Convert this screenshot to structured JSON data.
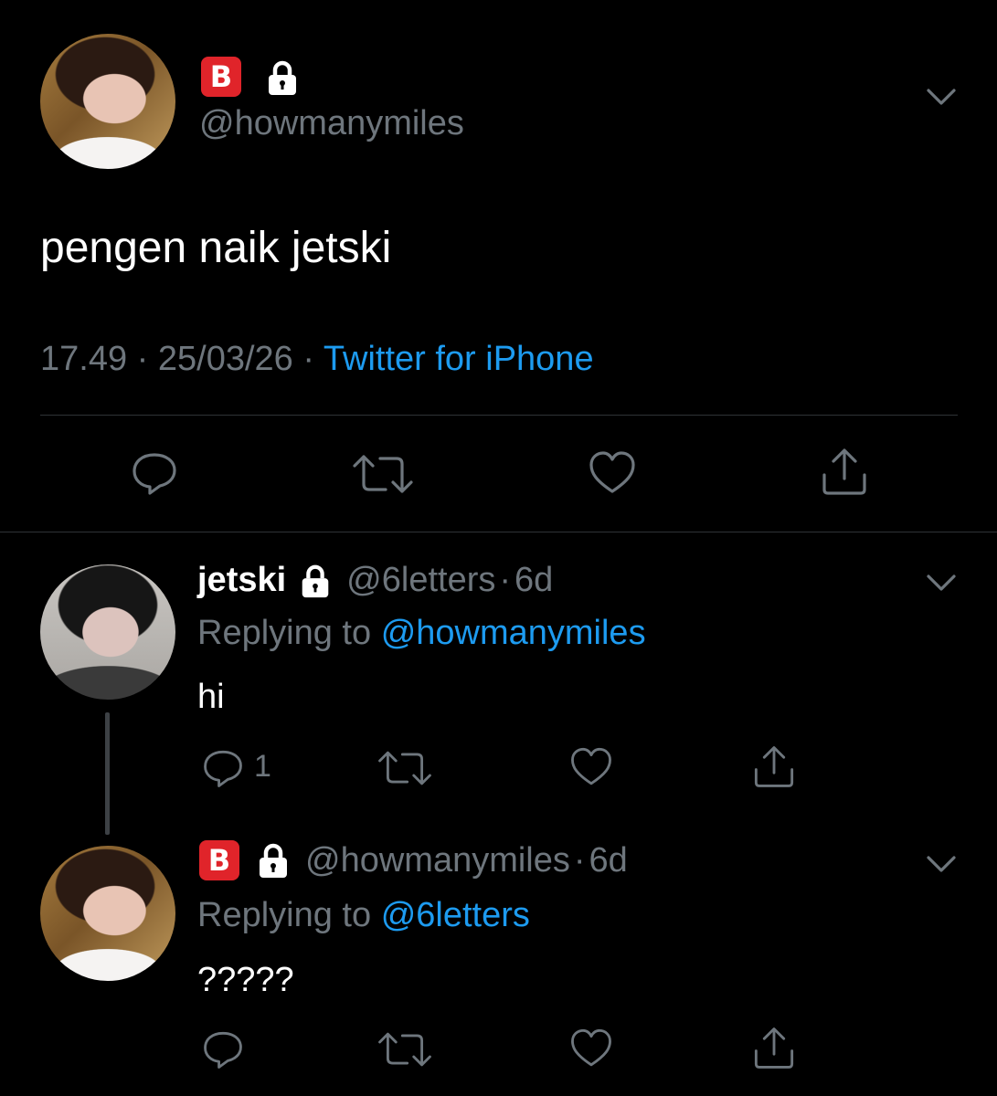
{
  "main_tweet": {
    "badge": "B",
    "handle": "@howmanymiles",
    "text": "pengen naik jetski",
    "time": "17.49",
    "sep1": "·",
    "date": "25/03/26",
    "sep2": "·",
    "source": "Twitter for iPhone"
  },
  "reply1": {
    "name": "jetski",
    "handle": "@6letters",
    "sep": "·",
    "age": "6d",
    "replying_prefix": "Replying to",
    "replying_to": "@howmanymiles",
    "text": "hi",
    "reply_count": "1"
  },
  "reply2": {
    "badge": "B",
    "handle": "@howmanymiles",
    "sep": "·",
    "age": "6d",
    "replying_prefix": "Replying to",
    "replying_to": "@6letters",
    "text": "?????"
  },
  "colors": {
    "background": "#000000",
    "text": "#ffffff",
    "secondary": "#6e767d",
    "link": "#1d9bf0",
    "badge": "#e0242a"
  }
}
